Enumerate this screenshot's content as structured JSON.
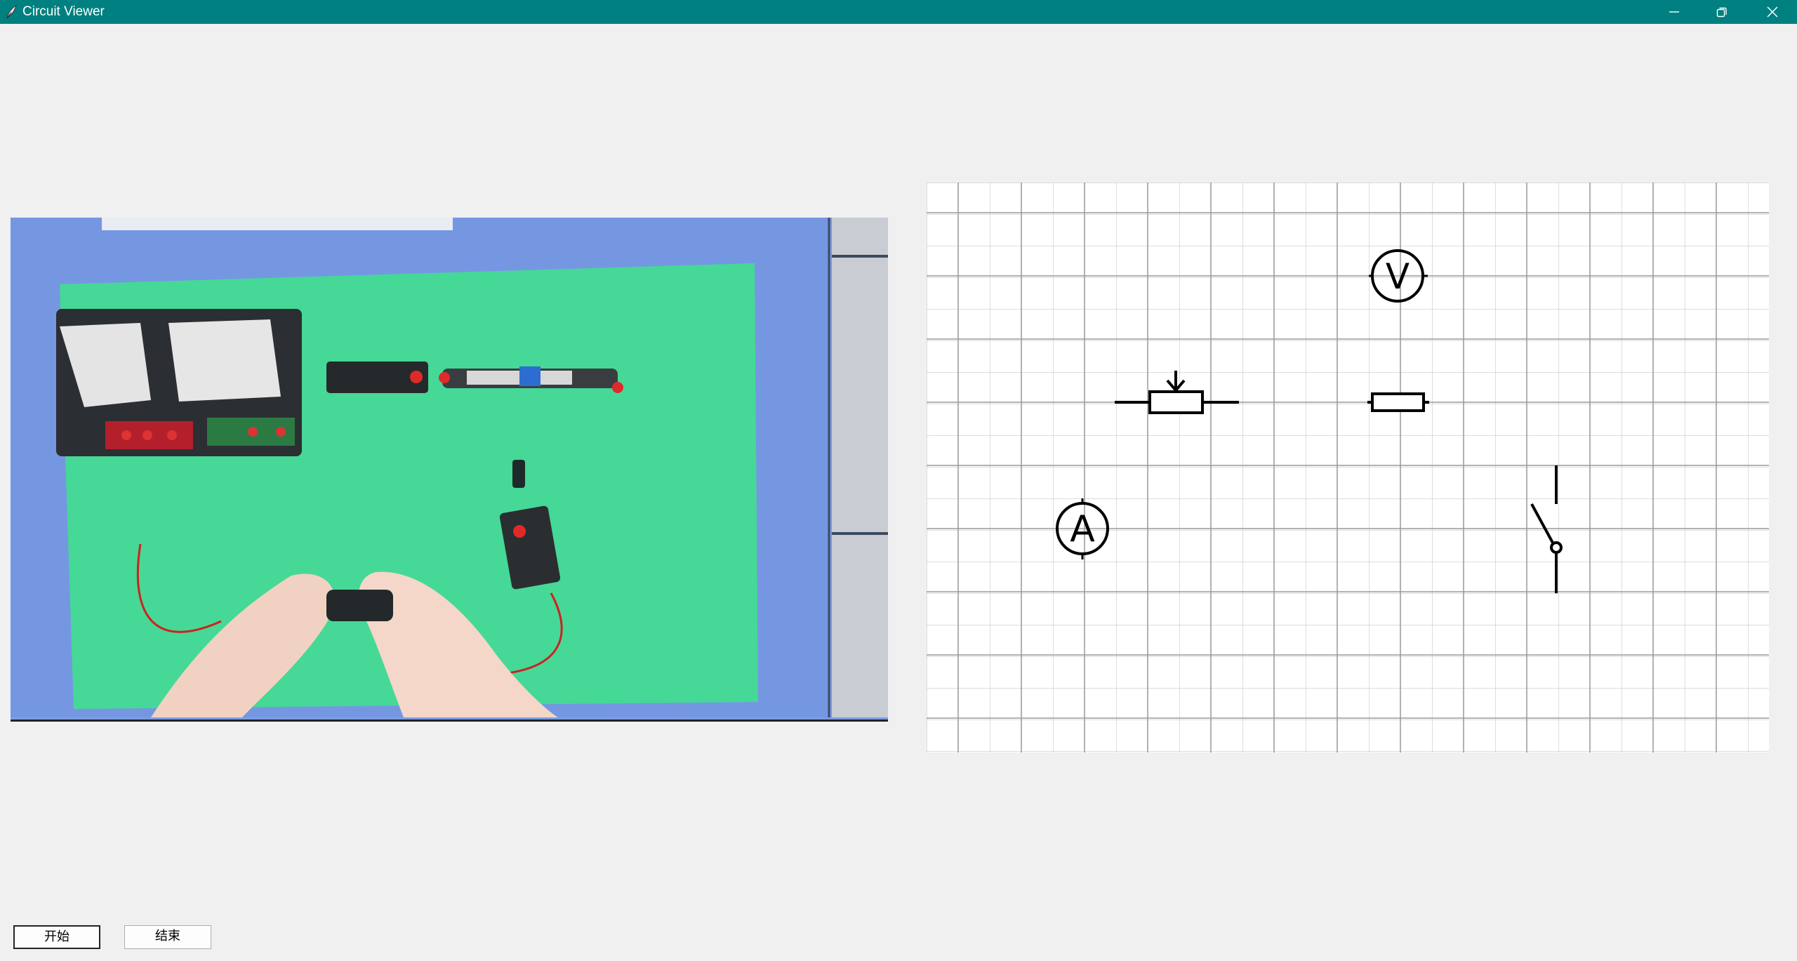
{
  "window": {
    "title": "Circuit Viewer",
    "titlebar_color": "#008080",
    "controls": [
      "minimize-icon",
      "restore-icon",
      "close-icon"
    ]
  },
  "video": {
    "description_icon": "camera-feed",
    "table_color": "#4fd69a",
    "border_color": "#7b9ce3"
  },
  "circuit": {
    "grid": true,
    "components": [
      {
        "name": "voltmeter",
        "symbol": "V"
      },
      {
        "name": "rheostat",
        "symbol": ""
      },
      {
        "name": "resistor",
        "symbol": ""
      },
      {
        "name": "ammeter",
        "symbol": "A"
      },
      {
        "name": "switch",
        "symbol": ""
      }
    ]
  },
  "buttons": {
    "start_label": "开始",
    "end_label": "结束"
  }
}
